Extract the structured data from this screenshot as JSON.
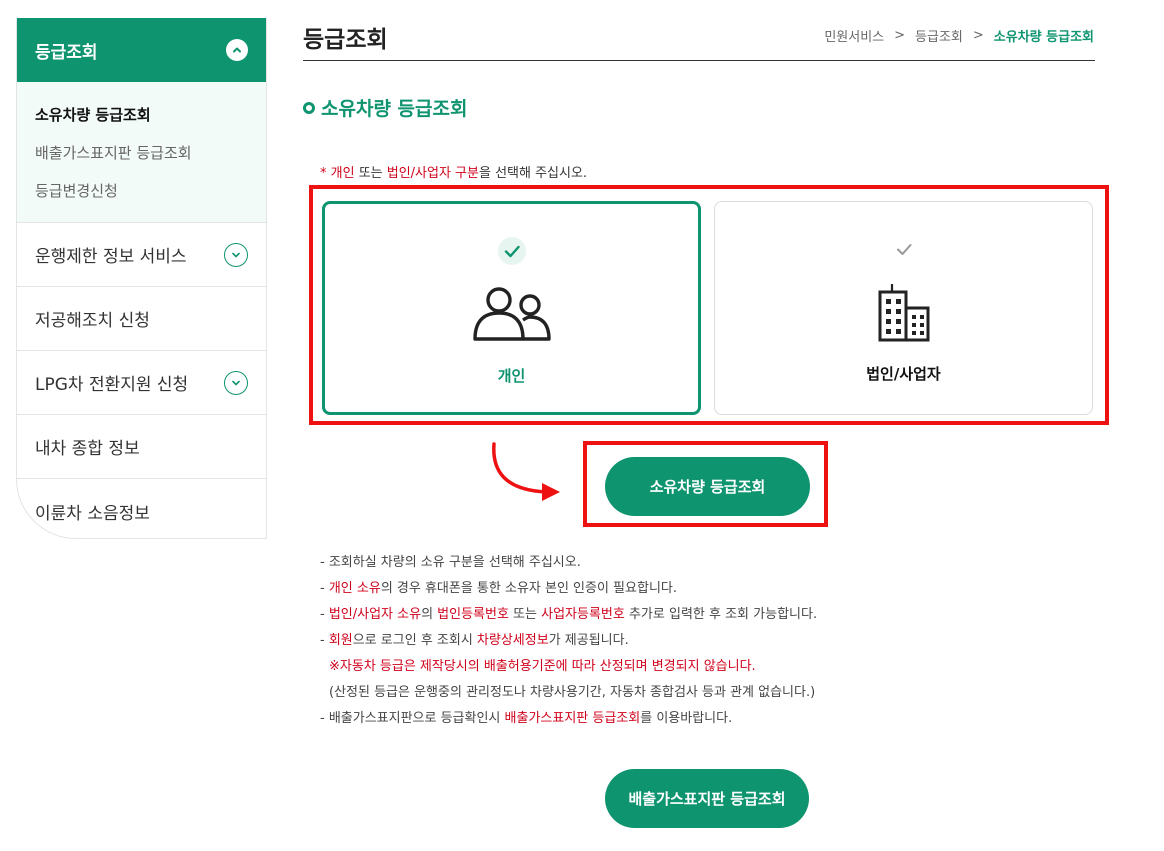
{
  "sidebar": {
    "header": "등급조회",
    "sub_items": [
      "소유차량 등급조회",
      "배출가스표지판 등급조회",
      "등급변경신청"
    ],
    "items": [
      "운행제한 정보 서비스",
      "저공해조치 신청",
      "LPG차 전환지원 신청",
      "내차 종합 정보",
      "이륜차 소음정보"
    ]
  },
  "page": {
    "title": "등급조회",
    "breadcrumb": [
      "민원서비스",
      ">",
      "등급조회",
      ">",
      "소유차량 등급조회"
    ],
    "section_title": "소유차량 등급조회"
  },
  "notice": {
    "prefix": "* ",
    "part1": "개인",
    "part2": " 또는 ",
    "part3": "법인/사업자 구분",
    "part4": "을 선택해 주십시오."
  },
  "options": {
    "person": "개인",
    "corp": "법인/사업자"
  },
  "buttons": {
    "lookup": "소유차량 등급조회",
    "emission": "배출가스표지판 등급조회"
  },
  "info": {
    "l1": "- 조회하실 차량의 소유 구분을 선택해 주십시오.",
    "l2a": "- ",
    "l2b": "개인 소유",
    "l2c": "의 경우 휴대폰을 통한 소유자 본인 인증이 필요합니다.",
    "l3a": "- ",
    "l3b": "법인/사업자 소유",
    "l3c": "의 ",
    "l3d": "법인등록번호",
    "l3e": " 또는 ",
    "l3f": "사업자등록번호",
    "l3g": " 추가로 입력한 후 조회 가능합니다.",
    "l4a": "- ",
    "l4b": "회원",
    "l4c": "으로 로그인 후 조회시 ",
    "l4d": "차량상세정보",
    "l4e": "가 제공됩니다.",
    "l5": "※자동차 등급은 제작당시의 배출허용기준에 따라 산정되며 변경되지 않습니다.",
    "l6": "(산정된 등급은 운행중의 관리정도나 차량사용기간, 자동차 종합검사 등과 관계 없습니다.)",
    "l7a": "- 배출가스표지판으로 등급확인시 ",
    "l7b": "배출가스표지판 등급조회",
    "l7c": "를 이용바랍니다."
  },
  "colors": {
    "accent": "#0f9470",
    "highlight": "#ee1111",
    "text_red": "#d0021b"
  }
}
